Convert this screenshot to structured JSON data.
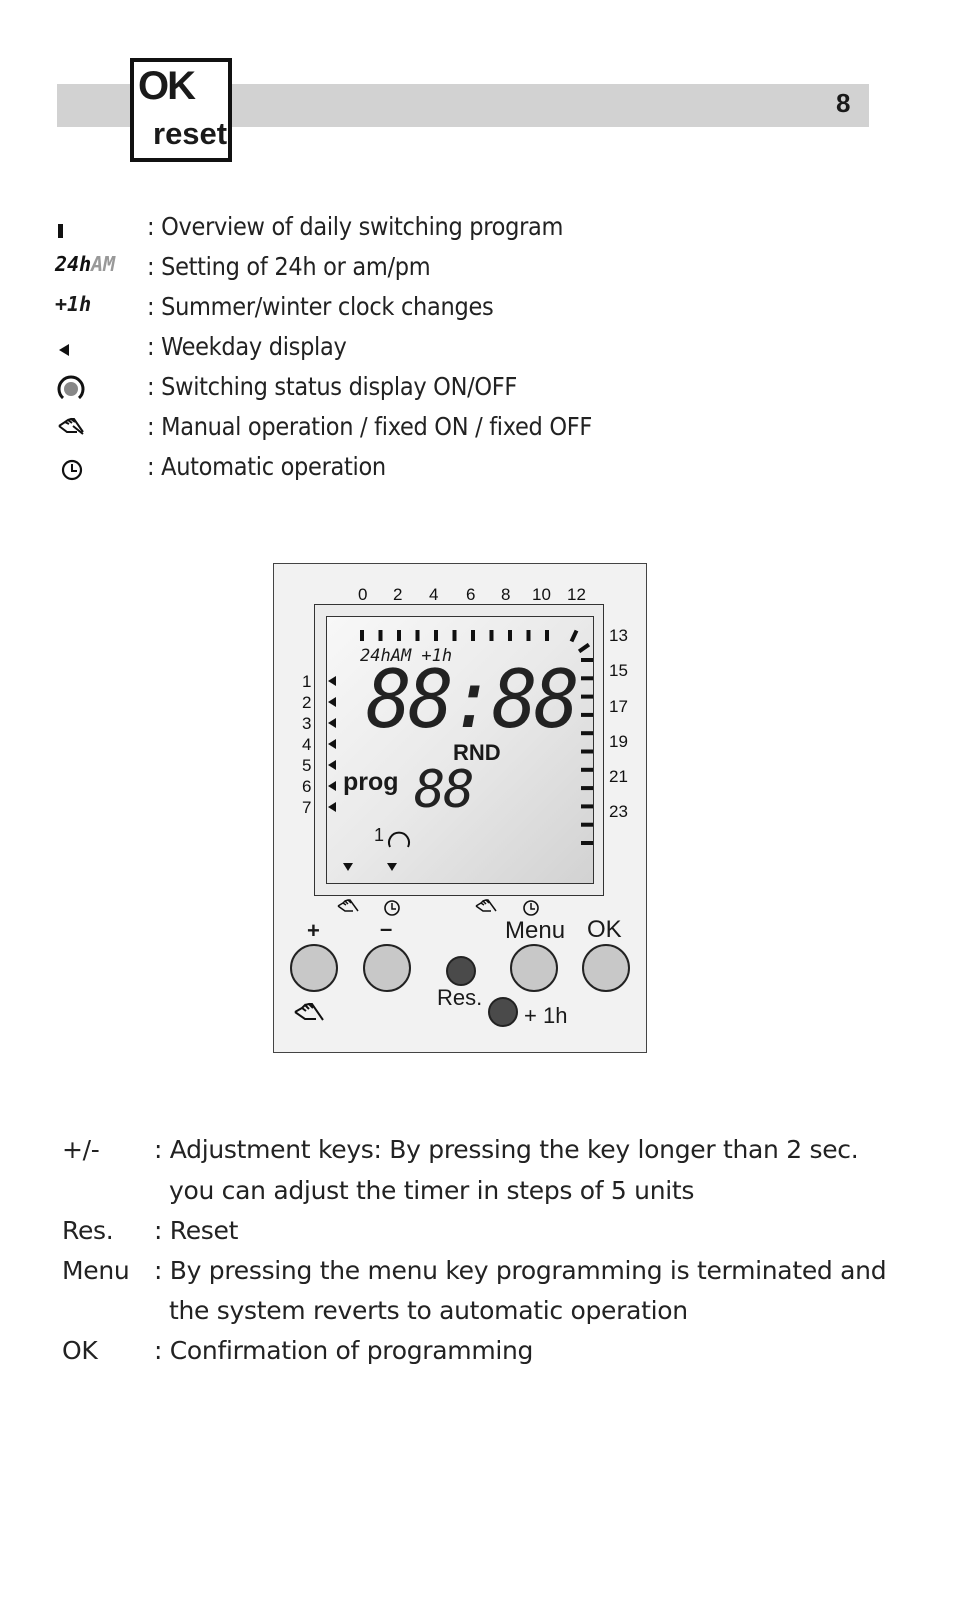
{
  "header": {
    "page_number": "8",
    "key_badge": {
      "top": "OK",
      "bottom": "reset"
    }
  },
  "legend": [
    {
      "symbol": "bar-segment-icon",
      "symbol_text": "",
      "text": ": Overview of daily switching program"
    },
    {
      "symbol": "24h-am-icon",
      "symbol_text": "24hAM",
      "text": ": Setting of 24h or am/pm"
    },
    {
      "symbol": "plus-1h-icon",
      "symbol_text": "+1h",
      "text": ": Summer/winter clock changes"
    },
    {
      "symbol": "triangle-left-icon",
      "symbol_text": "◀",
      "text": ": Weekday display"
    },
    {
      "symbol": "switch-status-icon",
      "symbol_text": "",
      "text": ": Switching status display ON/OFF"
    },
    {
      "symbol": "hand-icon",
      "symbol_text": "",
      "text": ": Manual operation / fixed ON / fixed OFF"
    },
    {
      "symbol": "clock-icon",
      "symbol_text": "",
      "text": ": Automatic operation"
    }
  ],
  "device": {
    "top_hours": [
      "0",
      "2",
      "4",
      "6",
      "8",
      "10",
      "12"
    ],
    "right_hours": [
      "13",
      "15",
      "17",
      "19",
      "21",
      "23"
    ],
    "weekdays": [
      "1",
      "2",
      "3",
      "4",
      "5",
      "6",
      "7"
    ],
    "lcd": {
      "mode_text": "24hAM +1h",
      "time": "88:88",
      "rnd": "RND",
      "prog_label": "prog",
      "prog_number": "88",
      "channel": "1"
    },
    "buttons": {
      "plus": "+",
      "minus": "–",
      "menu": "Menu",
      "ok": "OK",
      "res": "Res.",
      "plus1h": "+ 1h"
    }
  },
  "keys": [
    {
      "key": "+/-",
      "desc": ": Adjustment keys: By pressing the key longer than 2 sec.",
      "desc2": "you can adjust the timer in steps of 5 units"
    },
    {
      "key": "Res.",
      "desc": ": Reset",
      "desc2": ""
    },
    {
      "key": "Menu",
      "desc": ": By pressing the menu key programming is terminated and",
      "desc2": "the system reverts to automatic operation"
    },
    {
      "key": "OK",
      "desc": ": Confirmation of programming",
      "desc2": ""
    }
  ]
}
